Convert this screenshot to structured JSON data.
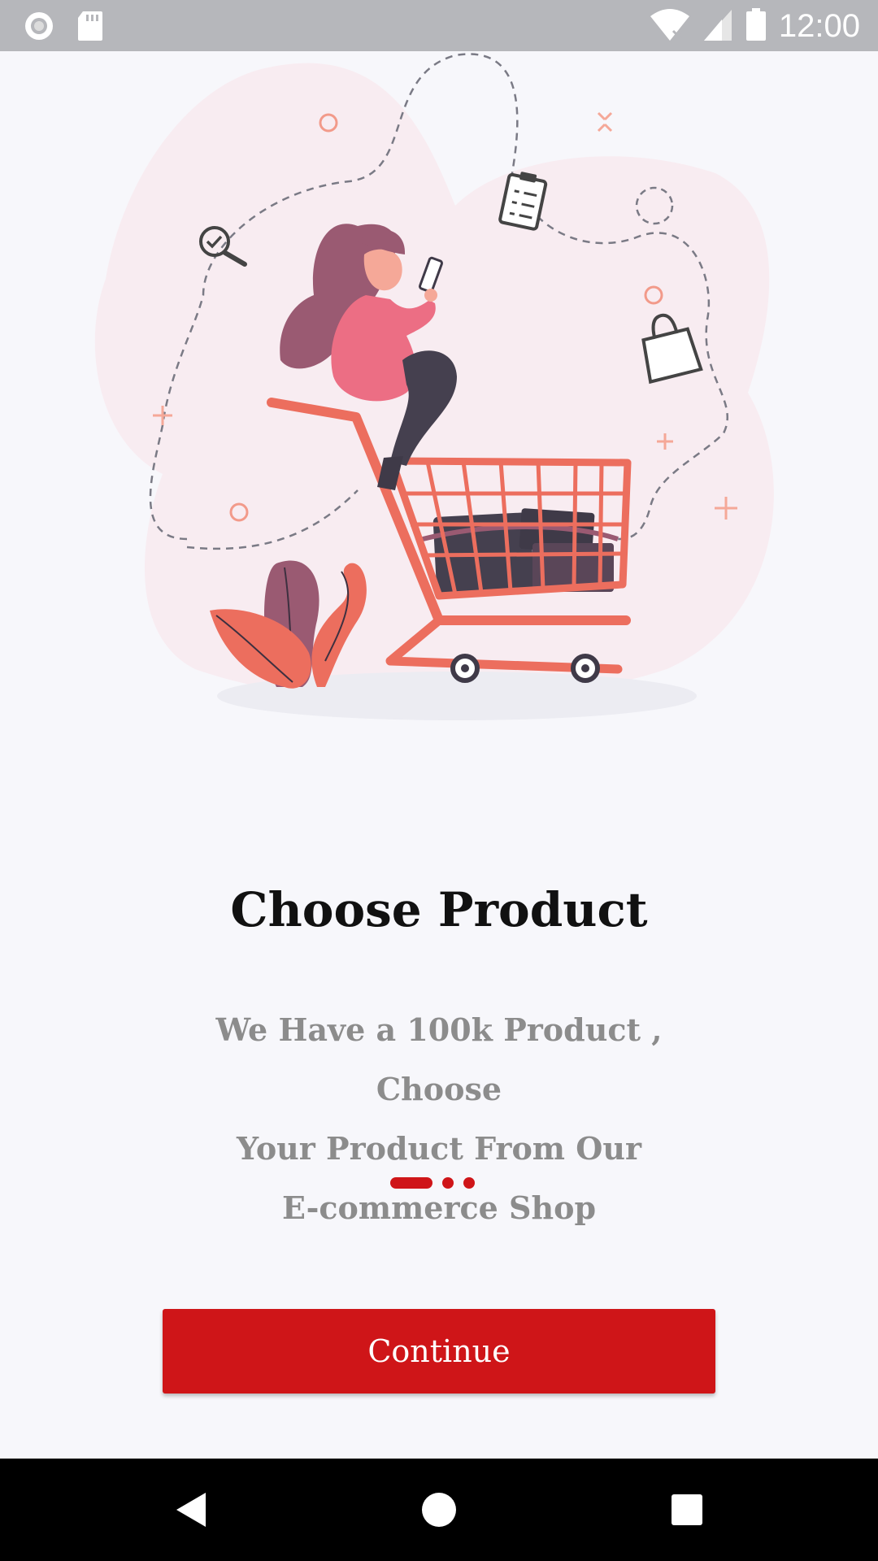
{
  "status_bar": {
    "time": "12:00",
    "icons": [
      "record-icon",
      "sd-card-icon",
      "wifi-icon",
      "signal-icon",
      "battery-icon"
    ]
  },
  "onboarding": {
    "title": "Choose Product",
    "description_lines": [
      "We Have a 100k Product , Choose",
      "Your Product From  Our",
      "E-commerce Shop"
    ],
    "page_count": 3,
    "active_page": 1,
    "continue_label": "Continue"
  },
  "colors": {
    "accent": "#cf1518",
    "status_bar": "#b6b7bb",
    "background": "#f7f7fb"
  },
  "nav_bar": {
    "icons": [
      "back-icon",
      "home-icon",
      "recents-icon"
    ]
  }
}
